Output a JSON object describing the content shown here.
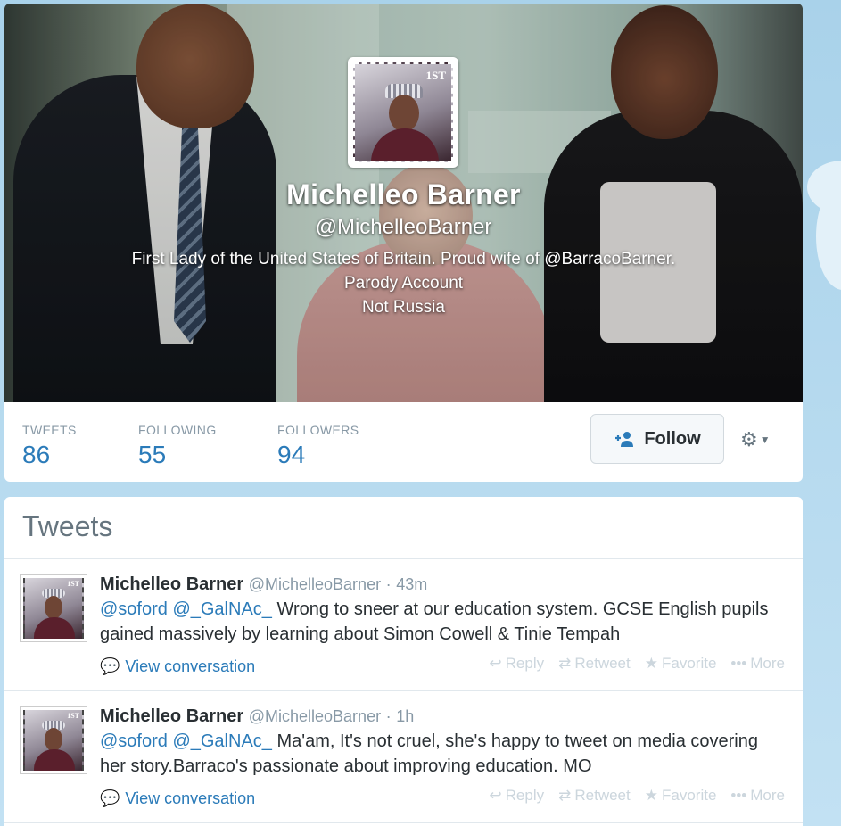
{
  "profile": {
    "name": "Michelleo Barner",
    "handle": "@MichelleoBarner",
    "bio_line1": "First Lady of the United States of Britain. Proud wife of @BarracoBarner.",
    "bio_line2": "Parody Account",
    "bio_line3": "Not Russia",
    "stamp_mark": "1ST"
  },
  "stats": [
    {
      "label": "TWEETS",
      "value": "86"
    },
    {
      "label": "FOLLOWING",
      "value": "55"
    },
    {
      "label": "FOLLOWERS",
      "value": "94"
    }
  ],
  "follow_button": {
    "label": "Follow",
    "icon": "add-user-icon"
  },
  "settings_menu": {
    "icon": "gear-icon"
  },
  "tweets_section": {
    "heading": "Tweets",
    "tweets": [
      {
        "author": "Michelleo Barner",
        "handle": "@MichelleoBarner",
        "time": "43m",
        "mention1": "@soford",
        "mention2": "@_GalNAc_",
        "text": "Wrong to sneer at our education system. GCSE English pupils gained massively by learning about Simon Cowell & Tinie Tempah",
        "view_conversation": "View conversation"
      },
      {
        "author": "Michelleo Barner",
        "handle": "@MichelleoBarner",
        "time": "1h",
        "mention1": "@soford",
        "mention2": "@_GalNAc_",
        "text": "Ma'am, It's not cruel, she's happy to tweet on media covering her story.Barraco's passionate about improving education. MO",
        "view_conversation": "View conversation"
      }
    ],
    "actions": {
      "reply": "Reply",
      "retweet": "Retweet",
      "favorite": "Favorite",
      "more": "More"
    }
  },
  "colors": {
    "link": "#2b7bb9",
    "muted": "#8899a6",
    "background": "#a9d2ea"
  }
}
